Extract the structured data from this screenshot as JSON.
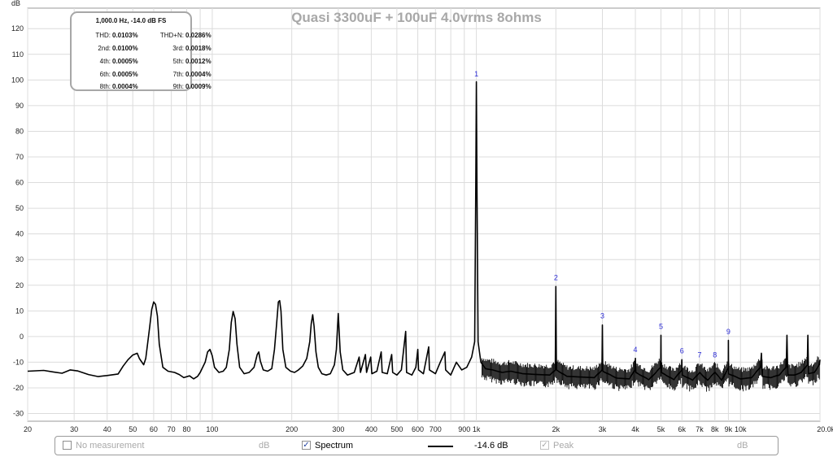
{
  "chart_data": {
    "type": "line",
    "title": "Quasi 3300uF + 100uF 4.0vrms 8ohms",
    "ylabel": "dB",
    "x_unit": "Hz",
    "x_scale": "log",
    "xlim": [
      20,
      20000
    ],
    "ylim": [
      -33,
      128
    ],
    "grid": true,
    "y_ticks": [
      "120",
      "110",
      "100",
      "90",
      "80",
      "70",
      "60",
      "50",
      "40",
      "30",
      "20",
      "10",
      "0",
      "-10",
      "-20",
      "-30"
    ],
    "y_tick_values": [
      120,
      110,
      100,
      90,
      80,
      70,
      60,
      50,
      40,
      30,
      20,
      10,
      0,
      -10,
      -20,
      -30
    ],
    "x_ticks": [
      {
        "v": 20,
        "label": "20"
      },
      {
        "v": 30,
        "label": "30"
      },
      {
        "v": 40,
        "label": "40"
      },
      {
        "v": 50,
        "label": "50"
      },
      {
        "v": 60,
        "label": "60"
      },
      {
        "v": 70,
        "label": "70"
      },
      {
        "v": 80,
        "label": "80"
      },
      {
        "v": 100,
        "label": "100"
      },
      {
        "v": 200,
        "label": "200"
      },
      {
        "v": 300,
        "label": "300"
      },
      {
        "v": 400,
        "label": "400"
      },
      {
        "v": 500,
        "label": "500"
      },
      {
        "v": 600,
        "label": "600"
      },
      {
        "v": 700,
        "label": "700"
      },
      {
        "v": 900,
        "label": "900"
      },
      {
        "v": 1000,
        "label": "1k"
      },
      {
        "v": 2000,
        "label": "2k"
      },
      {
        "v": 3000,
        "label": "3k"
      },
      {
        "v": 4000,
        "label": "4k"
      },
      {
        "v": 5000,
        "label": "5k"
      },
      {
        "v": 6000,
        "label": "6k"
      },
      {
        "v": 7000,
        "label": "7k"
      },
      {
        "v": 8000,
        "label": "8k"
      },
      {
        "v": 9000,
        "label": "9k"
      },
      {
        "v": 10000,
        "label": "10k"
      },
      {
        "v": 20000,
        "label": "20.0k Hz"
      }
    ],
    "series": [
      {
        "name": "Spectrum",
        "color": "#000000",
        "points": [
          [
            20,
            -13.5
          ],
          [
            23,
            -13.2
          ],
          [
            25,
            -13.8
          ],
          [
            27,
            -14.3
          ],
          [
            29,
            -13.0
          ],
          [
            31,
            -13.4
          ],
          [
            34,
            -14.8
          ],
          [
            37,
            -15.6
          ],
          [
            40,
            -15.2
          ],
          [
            44,
            -14.6
          ],
          [
            46,
            -11.5
          ],
          [
            48,
            -9.0
          ],
          [
            50,
            -7.2
          ],
          [
            52,
            -6.5
          ],
          [
            53,
            -8.6
          ],
          [
            55,
            -11.0
          ],
          [
            56,
            -8.5
          ],
          [
            58,
            4.0
          ],
          [
            59,
            10.5
          ],
          [
            60,
            13.5
          ],
          [
            61,
            12.5
          ],
          [
            62,
            8.0
          ],
          [
            63,
            -3.0
          ],
          [
            65,
            -12.0
          ],
          [
            68,
            -13.5
          ],
          [
            72,
            -14.0
          ],
          [
            75,
            -14.8
          ],
          [
            78,
            -16.0
          ],
          [
            82,
            -15.3
          ],
          [
            85,
            -16.5
          ],
          [
            88,
            -15.5
          ],
          [
            90,
            -14.0
          ],
          [
            94,
            -10.0
          ],
          [
            96,
            -6.0
          ],
          [
            98,
            -5.0
          ],
          [
            100,
            -7.5
          ],
          [
            102,
            -12.0
          ],
          [
            106,
            -14.0
          ],
          [
            110,
            -13.5
          ],
          [
            113,
            -12.0
          ],
          [
            116,
            -5.0
          ],
          [
            118,
            5.5
          ],
          [
            120,
            9.8
          ],
          [
            122,
            7.0
          ],
          [
            124,
            -3.0
          ],
          [
            127,
            -12.0
          ],
          [
            132,
            -14.5
          ],
          [
            138,
            -14.0
          ],
          [
            144,
            -12.0
          ],
          [
            148,
            -7.0
          ],
          [
            150,
            -6.0
          ],
          [
            152,
            -9.5
          ],
          [
            156,
            -13.0
          ],
          [
            162,
            -13.5
          ],
          [
            168,
            -12.5
          ],
          [
            172,
            -5.0
          ],
          [
            175,
            4.0
          ],
          [
            178,
            13.5
          ],
          [
            180,
            14.0
          ],
          [
            182,
            10.0
          ],
          [
            185,
            -5.0
          ],
          [
            190,
            -12.0
          ],
          [
            198,
            -13.5
          ],
          [
            205,
            -14.0
          ],
          [
            212,
            -13.0
          ],
          [
            220,
            -11.5
          ],
          [
            228,
            -8.5
          ],
          [
            234,
            -2.0
          ],
          [
            237,
            5.0
          ],
          [
            240,
            8.5
          ],
          [
            243,
            4.0
          ],
          [
            247,
            -6.0
          ],
          [
            252,
            -12.0
          ],
          [
            260,
            -14.5
          ],
          [
            270,
            -15.0
          ],
          [
            280,
            -14.5
          ],
          [
            290,
            -11.0
          ],
          [
            295,
            -5.0
          ],
          [
            300,
            9.0
          ],
          [
            305,
            -6.0
          ],
          [
            312,
            -13.0
          ],
          [
            325,
            -15.0
          ],
          [
            345,
            -14.0
          ],
          [
            360,
            -8.0
          ],
          [
            364,
            -14.0
          ],
          [
            380,
            -7.0
          ],
          [
            384,
            -14.0
          ],
          [
            398,
            -8.0
          ],
          [
            402,
            -14.5
          ],
          [
            420,
            -13.5
          ],
          [
            436,
            -6.0
          ],
          [
            440,
            -14.0
          ],
          [
            460,
            -14.5
          ],
          [
            478,
            -7.0
          ],
          [
            482,
            -14.0
          ],
          [
            500,
            -15.0
          ],
          [
            520,
            -13.0
          ],
          [
            540,
            2.0
          ],
          [
            544,
            -14.0
          ],
          [
            570,
            -15.0
          ],
          [
            590,
            -12.0
          ],
          [
            600,
            -5.0
          ],
          [
            604,
            -13.0
          ],
          [
            630,
            -14.5
          ],
          [
            660,
            -4.0
          ],
          [
            664,
            -13.0
          ],
          [
            700,
            -14.5
          ],
          [
            730,
            -10.0
          ],
          [
            760,
            -6.0
          ],
          [
            765,
            -13.0
          ],
          [
            800,
            -15.0
          ],
          [
            840,
            -10.0
          ],
          [
            880,
            -13.0
          ],
          [
            920,
            -12.0
          ],
          [
            960,
            -8.0
          ],
          [
            985,
            -2.0
          ],
          [
            995,
            60.0
          ],
          [
            1000,
            99.3
          ],
          [
            1005,
            60.0
          ],
          [
            1015,
            -2.0
          ],
          [
            1040,
            -10.0
          ],
          [
            1080,
            -12.5
          ],
          [
            1150,
            -13.0
          ],
          [
            1250,
            -14.0
          ],
          [
            1350,
            -13.5
          ],
          [
            1500,
            -14.5
          ],
          [
            1700,
            -14.8
          ],
          [
            1900,
            -15.0
          ],
          [
            1990,
            -13.0
          ],
          [
            2000,
            19.5
          ],
          [
            2010,
            -13.0
          ],
          [
            2200,
            -15.5
          ],
          [
            2500,
            -15.8
          ],
          [
            2800,
            -16.0
          ],
          [
            2990,
            -13.0
          ],
          [
            3000,
            4.5
          ],
          [
            3010,
            -13.5
          ],
          [
            3400,
            -16.2
          ],
          [
            3800,
            -16.5
          ],
          [
            3990,
            -13.0
          ],
          [
            4000,
            -8.5
          ],
          [
            4010,
            -14.0
          ],
          [
            4500,
            -16.8
          ],
          [
            4990,
            -12.0
          ],
          [
            5000,
            0.5
          ],
          [
            5010,
            -14.0
          ],
          [
            5600,
            -16.8
          ],
          [
            5990,
            -13.0
          ],
          [
            6000,
            -9.0
          ],
          [
            6010,
            -15.0
          ],
          [
            6600,
            -17.0
          ],
          [
            7000,
            -14.0
          ],
          [
            7500,
            -17.0
          ],
          [
            8000,
            -14.0
          ],
          [
            8500,
            -17.0
          ],
          [
            8990,
            -12.0
          ],
          [
            9000,
            -1.5
          ],
          [
            9010,
            -14.5
          ],
          [
            10000,
            -16.5
          ],
          [
            11000,
            -16.0
          ],
          [
            11900,
            -12.0
          ],
          [
            12000,
            -6.5
          ],
          [
            12100,
            -15.5
          ],
          [
            13000,
            -16.0
          ],
          [
            14000,
            -15.0
          ],
          [
            14900,
            -12.0
          ],
          [
            15000,
            0.5
          ],
          [
            15100,
            -15.0
          ],
          [
            16000,
            -15.0
          ],
          [
            17000,
            -14.0
          ],
          [
            17900,
            -11.0
          ],
          [
            18000,
            0.5
          ],
          [
            18100,
            -14.5
          ],
          [
            19000,
            -14.0
          ],
          [
            19900,
            -11.0
          ],
          [
            20000,
            -9.0
          ]
        ]
      }
    ],
    "harmonic_markers": [
      {
        "label": "1",
        "freq": 1000,
        "db": 100.5
      },
      {
        "label": "2",
        "freq": 2000,
        "db": 21.0
      },
      {
        "label": "3",
        "freq": 3000,
        "db": 6.2
      },
      {
        "label": "4",
        "freq": 4000,
        "db": -7.0
      },
      {
        "label": "5",
        "freq": 5000,
        "db": 2.0
      },
      {
        "label": "6",
        "freq": 6000,
        "db": -7.5
      },
      {
        "label": "7",
        "freq": 7000,
        "db": -9.0
      },
      {
        "label": "8",
        "freq": 8000,
        "db": -9.0
      },
      {
        "label": "9",
        "freq": 9000,
        "db": 0.0
      }
    ]
  },
  "distortion_box": {
    "header": "1,000.0 Hz, -14.0 dB FS",
    "rows": [
      {
        "l1": "THD:",
        "v1": "0.0103%",
        "l2": "THD+N:",
        "v2": "0.0286%"
      },
      {
        "l1": "2nd:",
        "v1": "0.0100%",
        "l2": "3rd:",
        "v2": "0.0018%"
      },
      {
        "l1": "4th:",
        "v1": "0.0005%",
        "l2": "5th:",
        "v2": "0.0012%"
      },
      {
        "l1": "6th:",
        "v1": "0.0005%",
        "l2": "7th:",
        "v2": "0.0004%"
      },
      {
        "l1": "8th:",
        "v1": "0.0004%",
        "l2": "9th:",
        "v2": "0.0009%"
      }
    ]
  },
  "legend": {
    "no_measurement": {
      "label": "No measurement",
      "unit": "dB",
      "checked": false
    },
    "spectrum": {
      "label": "Spectrum",
      "value": "-14.6 dB",
      "checked": true,
      "check_mark": "✓"
    },
    "peak": {
      "label": "Peak",
      "unit": "dB",
      "checked": true,
      "check_mark": "✓"
    }
  }
}
